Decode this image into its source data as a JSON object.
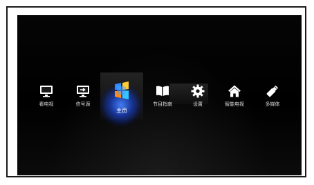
{
  "menu": {
    "items": [
      {
        "label": "看电视",
        "icon": "tv-icon"
      },
      {
        "label": "信号源",
        "icon": "input-source-icon"
      },
      {
        "label": "主页",
        "icon": "home-tiles-icon"
      },
      {
        "label": "节目指南",
        "icon": "open-book-icon"
      },
      {
        "label": "设置",
        "icon": "gear-icon"
      },
      {
        "label": "智能电视",
        "icon": "house-icon"
      },
      {
        "label": "多媒体",
        "icon": "usb-drive-icon"
      }
    ],
    "selected_index": 2
  },
  "colors": {
    "screen_background": "#000000",
    "selection_glow": "#3f7cff",
    "label_text": "#dcdcdc",
    "frame_border": "#1a1a1a"
  }
}
